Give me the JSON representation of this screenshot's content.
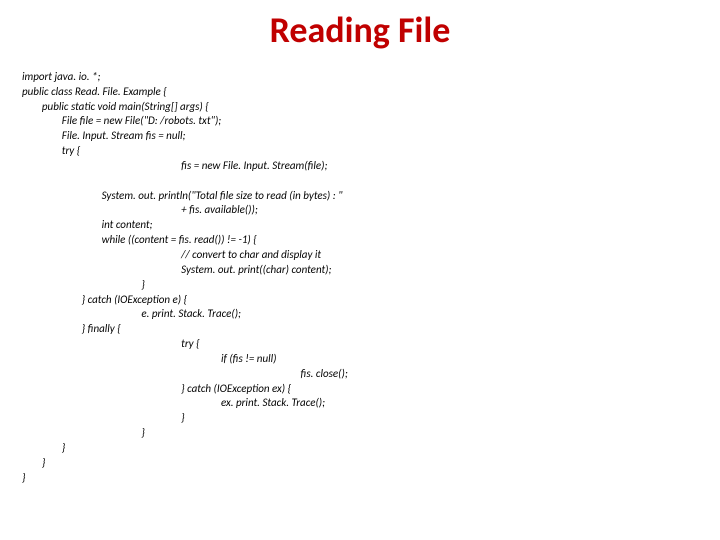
{
  "title": "Reading File",
  "code": {
    "l01": "import java. io. *;",
    "l02": "public class Read. File. Example {",
    "l03": "        public static void main(String[] args) {",
    "l04": "                File file = new File(\"D: /robots. txt\");",
    "l05": "                File. Input. Stream fis = null;",
    "l06": "                try {",
    "l07": "                                                                fis = new File. Input. Stream(file);",
    "l08": "",
    "l09": "                                System. out. println(\"Total file size to read (in bytes) : \"",
    "l10": "                                                                + fis. available());",
    "l11": "                                int content;",
    "l12": "                                while ((content = fis. read()) != -1) {",
    "l13": "                                                                // convert to char and display it",
    "l14": "                                                                System. out. print((char) content);",
    "l15": "                                                }",
    "l16": "                        } catch (IOException e) {",
    "l17": "                                                e. print. Stack. Trace();",
    "l18": "                        } finally {",
    "l19": "                                                                try {",
    "l20": "                                                                                if (fis != null)",
    "l21": "                                                                                                                fis. close();",
    "l22": "                                                                } catch (IOException ex) {",
    "l23": "                                                                                ex. print. Stack. Trace();",
    "l24": "                                                                }",
    "l25": "                                                }",
    "l26": "                }",
    "l27": "        }",
    "l28": "}"
  }
}
